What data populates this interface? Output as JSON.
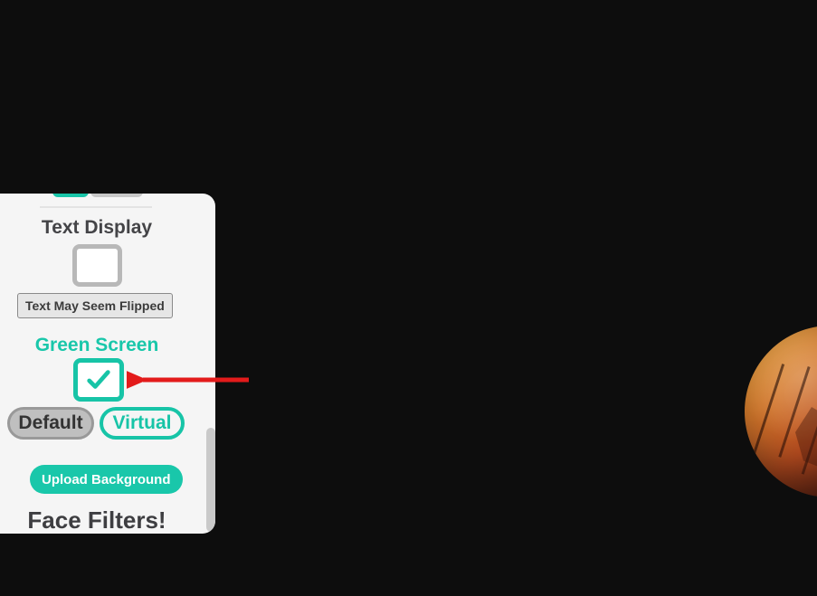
{
  "panel": {
    "text_display": {
      "heading": "Text Display",
      "hint": "Text May Seem Flipped"
    },
    "green_screen": {
      "heading": "Green Screen",
      "toggle": {
        "default_label": "Default",
        "virtual_label": "Virtual"
      },
      "upload_label": "Upload Background"
    },
    "face_filters": {
      "heading": "Face Filters!"
    }
  },
  "colors": {
    "accent": "#17c4a7",
    "muted": "#b8b8b8",
    "arrow": "#e31b1b"
  }
}
